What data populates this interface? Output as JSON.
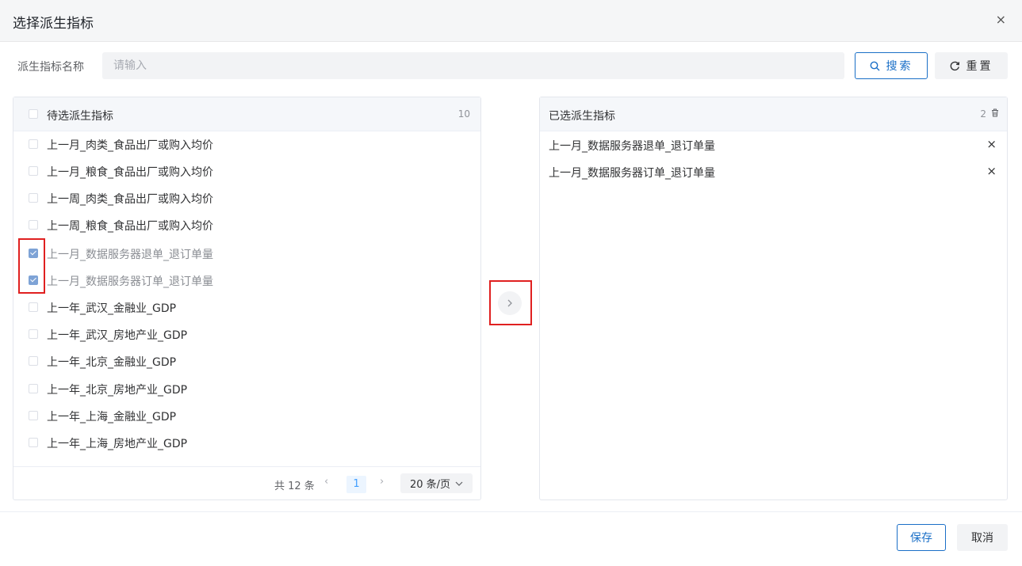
{
  "dialog": {
    "title": "选择派生指标",
    "close": "×"
  },
  "search": {
    "label": "派生指标名称",
    "placeholder": "请输入",
    "value": "",
    "search_btn": "搜索",
    "reset_btn": "重置"
  },
  "left_panel": {
    "title": "待选派生指标",
    "count": "10",
    "items": [
      {
        "label": "上一月_肉类_食品出厂或购入均价",
        "checked": false
      },
      {
        "label": "上一月_粮食_食品出厂或购入均价",
        "checked": false
      },
      {
        "label": "上一周_肉类_食品出厂或购入均价",
        "checked": false
      },
      {
        "label": "上一周_粮食_食品出厂或购入均价",
        "checked": false
      },
      {
        "label": "上一月_数据服务器退单_退订单量",
        "checked": true
      },
      {
        "label": "上一月_数据服务器订单_退订单量",
        "checked": true
      },
      {
        "label": "上一年_武汉_金融业_GDP",
        "checked": false
      },
      {
        "label": "上一年_武汉_房地产业_GDP",
        "checked": false
      },
      {
        "label": "上一年_北京_金融业_GDP",
        "checked": false
      },
      {
        "label": "上一年_北京_房地产业_GDP",
        "checked": false
      },
      {
        "label": "上一年_上海_金融业_GDP",
        "checked": false
      },
      {
        "label": "上一年_上海_房地产业_GDP",
        "checked": false
      }
    ],
    "pager": {
      "total": "共 12 条",
      "prev": "‹",
      "page": "1",
      "next": "›",
      "size": "20 条/页"
    }
  },
  "right_panel": {
    "title": "已选派生指标",
    "count": "2",
    "items": [
      {
        "label": "上一月_数据服务器退单_退订单量"
      },
      {
        "label": "上一月_数据服务器订单_退订单量"
      }
    ],
    "remove": "×"
  },
  "footer": {
    "save": "保存",
    "cancel": "取消"
  },
  "colors": {
    "primary": "#1a6fc7",
    "checked": "#7ea3d6",
    "highlight": "#e02020",
    "header_bg": "#f5f6f7"
  }
}
